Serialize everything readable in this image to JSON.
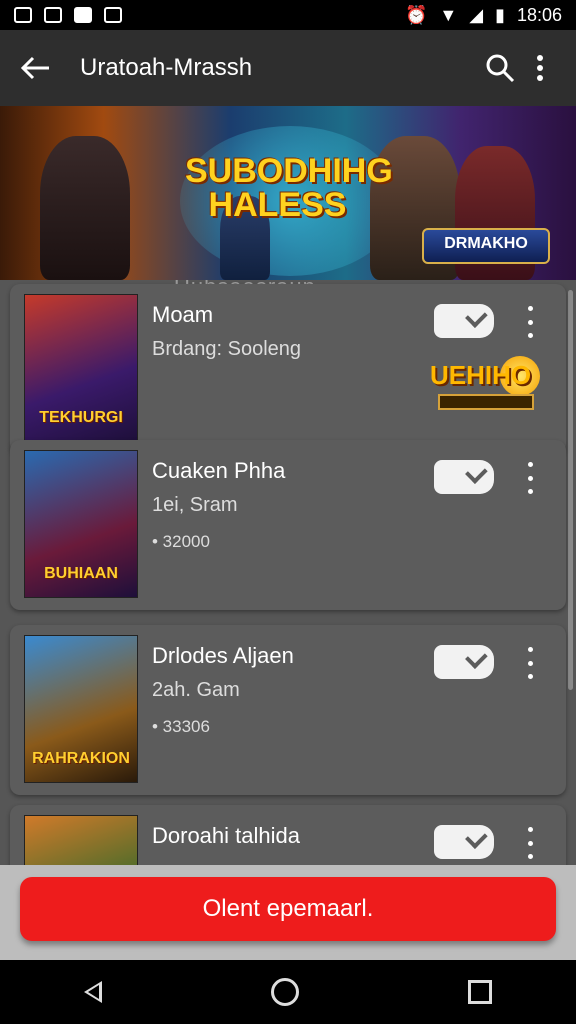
{
  "status_bar": {
    "time": "18:06"
  },
  "app_bar": {
    "title": "Uratoah-Mrassh"
  },
  "banner": {
    "headline": "SUBODHIHG HALESS",
    "badge_text": "DRMAKHO"
  },
  "section_label": "Uubsaasraun",
  "items": [
    {
      "title": "Moam",
      "subtitle": "Brdang: Sooleng",
      "meta": "",
      "thumb_text": "TEKHURGI",
      "badge_text": "UEHIHO"
    },
    {
      "title": "Cuaken Phha",
      "subtitle": "1ei, Sram",
      "meta": "• 32000",
      "thumb_text": "BUHIAAN"
    },
    {
      "title": "Drlodes Aljaen",
      "subtitle": "2ah. Gam",
      "meta": "• 33306",
      "thumb_text": "RAHRAKION"
    },
    {
      "title": "Doroahi talhida",
      "subtitle": "",
      "meta": "",
      "thumb_text": ""
    }
  ],
  "cta": {
    "label": "Olent epemaarl."
  },
  "colors": {
    "accent": "#ee1c1c",
    "app_bar": "#2e2e2e",
    "card": "#5c5c5c"
  },
  "icons": [
    "back-arrow-icon",
    "search-icon",
    "more-vert-icon",
    "nav-back-icon",
    "nav-home-icon",
    "nav-recent-icon"
  ]
}
